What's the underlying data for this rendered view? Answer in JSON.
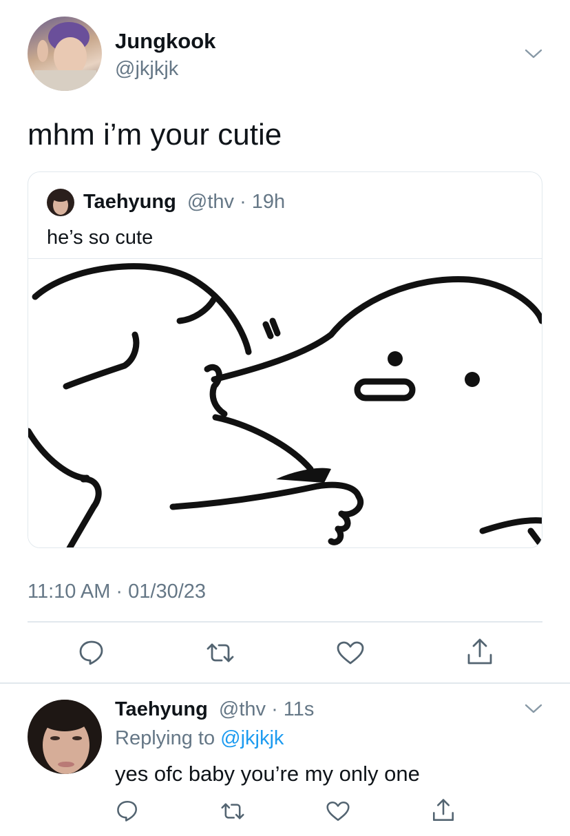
{
  "tweet": {
    "author_name": "Jungkook",
    "author_handle": "@jkjkjk",
    "text": "mhm i’m your cutie",
    "timestamp": "11:10 AM · 01/30/23",
    "quote": {
      "author_name": "Taehyung",
      "author_handle": "@thv",
      "separator": "·",
      "time": "19h",
      "text": "he’s so cute"
    }
  },
  "reply": {
    "author_name": "Taehyung",
    "author_handle": "@thv",
    "separator": "·",
    "time": "11s",
    "replying_prefix": "Replying to",
    "replying_handle": "@jkjkjk",
    "text": "yes ofc baby you’re my only one"
  },
  "icons": {
    "menu": "chevron-down-icon",
    "reply": "comment-icon",
    "retweet": "retweet-icon",
    "like": "heart-icon",
    "share": "share-icon"
  },
  "colors": {
    "link": "#1d9bf0",
    "muted": "#657786",
    "divider": "#e1e8ed"
  }
}
